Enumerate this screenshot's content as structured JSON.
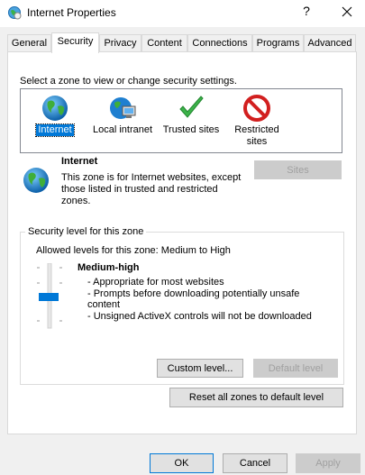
{
  "window": {
    "title": "Internet Properties",
    "help": "?",
    "close_icon": "close-icon"
  },
  "tabs": [
    "General",
    "Security",
    "Privacy",
    "Content",
    "Connections",
    "Programs",
    "Advanced"
  ],
  "active_tab": "Security",
  "zones": {
    "prompt": "Select a zone to view or change security settings.",
    "items": [
      {
        "label": "Internet",
        "icon": "globe-icon",
        "selected": true
      },
      {
        "label": "Local intranet",
        "icon": "intranet-icon",
        "selected": false
      },
      {
        "label": "Trusted sites",
        "icon": "checkmark-icon",
        "selected": false
      },
      {
        "label": "Restricted\nsites",
        "icon": "restricted-icon",
        "selected": false
      }
    ]
  },
  "zone_info": {
    "title": "Internet",
    "description": "This zone is for Internet websites, except those listed in trusted and restricted zones.",
    "sites_button": "Sites"
  },
  "security_level": {
    "group_label": "Security level for this zone",
    "allowed": "Allowed levels for this zone: Medium to High",
    "level_name": "Medium-high",
    "slider_level": "Medium-high",
    "bullets": [
      "- Appropriate for most websites",
      "- Prompts before downloading potentially unsafe",
      "content",
      "- Unsigned ActiveX controls will not be downloaded"
    ],
    "custom_button": "Custom level...",
    "default_button": "Default level"
  },
  "reset_button": "Reset all zones to default level",
  "footer": {
    "ok": "OK",
    "cancel": "Cancel",
    "apply": "Apply"
  },
  "colors": {
    "selection": "#0078d7",
    "slider_thumb": "#0078d7",
    "disabled_text": "#a0a0a0"
  }
}
